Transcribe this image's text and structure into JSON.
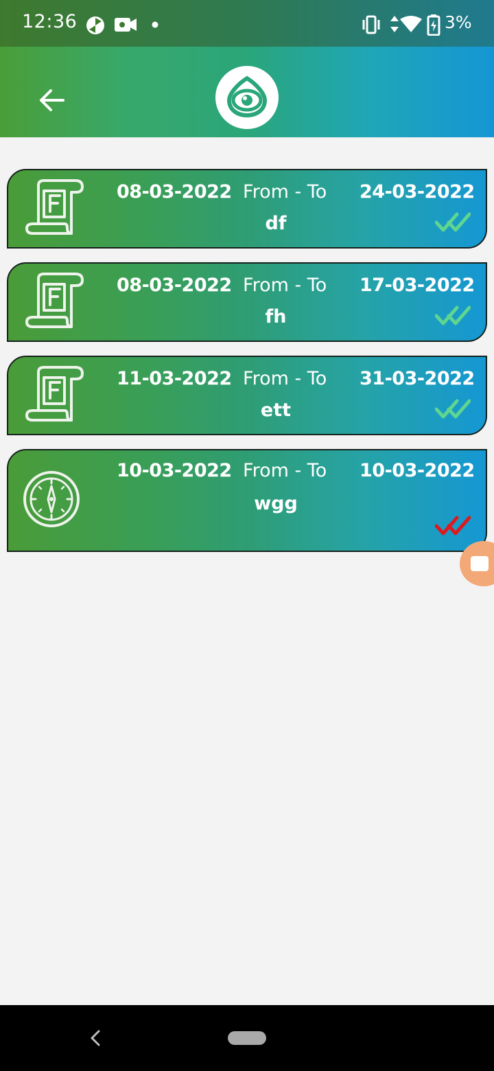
{
  "status_bar": {
    "time": "12:36",
    "battery_percent": "3%",
    "icons": [
      "pinwheel-app-icon",
      "video-camera-icon",
      "notification-dot-icon",
      "vibrate-icon",
      "data-arrows-icon",
      "wifi-icon",
      "battery-charging-icon"
    ]
  },
  "app_bar": {
    "back_icon": "arrow-left-icon",
    "logo_icon": "eye-logo-icon"
  },
  "entries": [
    {
      "icon": "document-f-icon",
      "from_date": "08-03-2022",
      "separator": "From - To",
      "to_date": "24-03-2022",
      "title": "df",
      "status_icon": "double-check-icon",
      "status_color": "#5fd68f"
    },
    {
      "icon": "document-f-icon",
      "from_date": "08-03-2022",
      "separator": "From - To",
      "to_date": "17-03-2022",
      "title": "fh",
      "status_icon": "double-check-icon",
      "status_color": "#5fd68f"
    },
    {
      "icon": "document-f-icon",
      "from_date": "11-03-2022",
      "separator": "From - To",
      "to_date": "31-03-2022",
      "title": "ett",
      "status_icon": "double-check-icon",
      "status_color": "#5fd68f"
    },
    {
      "icon": "clock-dial-icon",
      "from_date": "10-03-2022",
      "separator": "From - To",
      "to_date": "10-03-2022",
      "title": "wgg",
      "status_icon": "double-check-icon",
      "status_color": "#e0191c"
    }
  ],
  "colors": {
    "gradient_start": "#4a9e38",
    "gradient_end": "#1596d4",
    "background": "#f4f3f4",
    "approved": "#5fd68f",
    "rejected": "#e0191c",
    "floating_badge": "#f3a878"
  },
  "nav_bar": {
    "back_icon": "nav-back-chevron-icon",
    "home_icon": "nav-home-pill-icon"
  }
}
